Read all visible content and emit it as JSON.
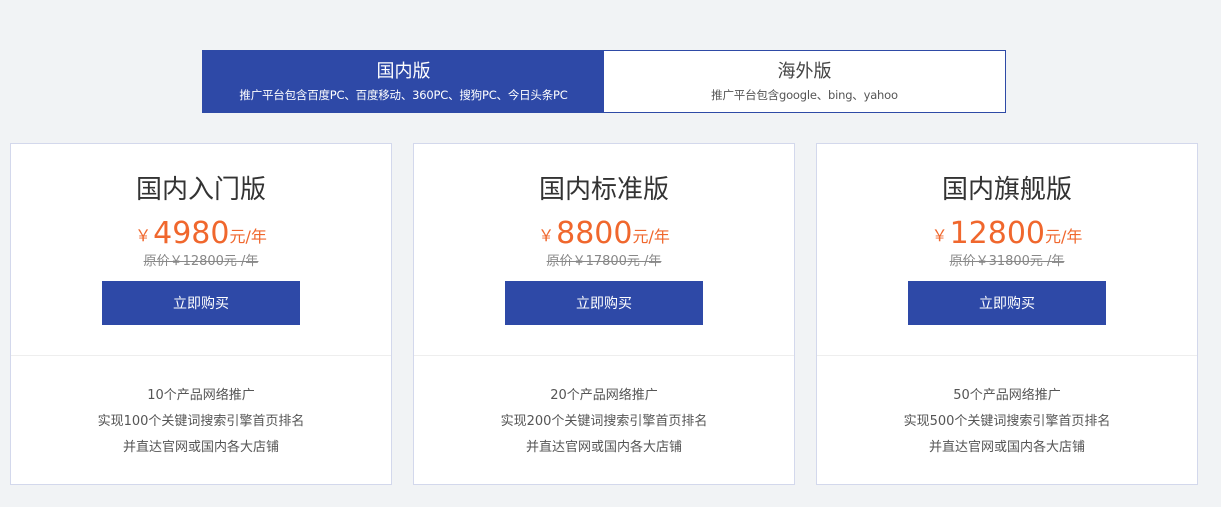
{
  "tabs": [
    {
      "title": "国内版",
      "subtitle": "推广平台包含百度PC、百度移动、360PC、搜狗PC、今日头条PC",
      "active": true
    },
    {
      "title": "海外版",
      "subtitle": "推广平台包含google、bing、yahoo",
      "active": false
    }
  ],
  "plans": [
    {
      "name": "国内入门版",
      "currency": "￥",
      "price": "4980",
      "unit": "元/年",
      "original": "原价￥12800元 /年",
      "button": "立即购买",
      "features": [
        "10个产品网络推广",
        "实现100个关键词搜索引擎首页排名",
        "并直达官网或国内各大店铺"
      ]
    },
    {
      "name": "国内标准版",
      "currency": "￥",
      "price": "8800",
      "unit": "元/年",
      "original": "原价￥17800元 /年",
      "button": "立即购买",
      "features": [
        "20个产品网络推广",
        "实现200个关键词搜索引擎首页排名",
        "并直达官网或国内各大店铺"
      ]
    },
    {
      "name": "国内旗舰版",
      "currency": "￥",
      "price": "12800",
      "unit": "元/年",
      "original": "原价￥31800元 /年",
      "button": "立即购买",
      "features": [
        "50个产品网络推广",
        "实现500个关键词搜索引擎首页排名",
        "并直达官网或国内各大店铺"
      ]
    }
  ],
  "colors": {
    "primary": "#2e49a7",
    "price": "#f0672d",
    "background": "#f1f3f5"
  }
}
